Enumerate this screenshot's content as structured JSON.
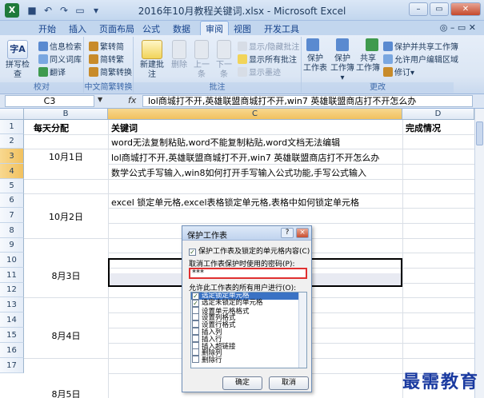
{
  "window": {
    "title": "2016年10月教程关键词.xlsx - Microsoft Excel",
    "app_icon": "X"
  },
  "ribbon_tabs": [
    "开始",
    "插入",
    "页面布局",
    "公式",
    "数据",
    "审阅",
    "视图",
    "开发工具"
  ],
  "active_tab": "审阅",
  "ribbon": {
    "proofing": {
      "label": "校对",
      "spell_check": "拼写检查",
      "research": "信息检索",
      "thesaurus": "同义词库",
      "translate": "翻译"
    },
    "chinese": {
      "label": "中文简繁转换",
      "to_trad": "繁转简",
      "to_simp": "简转繁",
      "convert": "简繁转换"
    },
    "comments": {
      "label": "批注",
      "new": "新建批注",
      "delete": "删除",
      "prev": "上一条",
      "next": "下一条",
      "show_hide": "显示/隐藏批注",
      "show_all": "显示所有批注",
      "show_ink": "显示墨迹"
    },
    "changes": {
      "label": "更改",
      "protect_sheet_1": "保护",
      "protect_sheet_2": "工作表",
      "protect_wb_1": "保护",
      "protect_wb_2": "工作簿",
      "share_1": "共享",
      "share_2": "工作簿",
      "protect_share": "保护并共享工作簿",
      "allow_edit": "允许用户编辑区域",
      "track": "修订"
    }
  },
  "formula_bar": {
    "name_box": "C3",
    "fx": "fx",
    "formula": "lol商城打不开,英雄联盟商城打不开,win7 英雄联盟商店打不开怎么办"
  },
  "columns": [
    "B",
    "C",
    "D"
  ],
  "rows": [
    "1",
    "2",
    "3",
    "4",
    "5",
    "6",
    "7",
    "8",
    "9",
    "10",
    "11",
    "12",
    "13",
    "14",
    "15",
    "16",
    "17"
  ],
  "cells": {
    "b1": "每天分配",
    "c1": "关键词",
    "d1": "完成情况",
    "c2": "word无法复制粘贴,word不能复制粘贴,word文档无法编辑",
    "b_day1": "10月1日",
    "c3": "lol商城打不开,英雄联盟商城打不开,win7 英雄联盟商店打不开怎么办",
    "c4": "数学公式手写输入,win8如何打开手写输入公式功能,手写公式输入",
    "c6": "excel 锁定单元格,excel表格锁定单元格,表格中如何锁定单元格",
    "b_day2": "10月2日",
    "b_day3": "8月3日",
    "b_day4": "8月4日",
    "b_day5": "8月5日"
  },
  "dialog": {
    "title": "保护工作表",
    "help": "?",
    "close": "×",
    "protect_check": "保护工作表及锁定的单元格内容(C)",
    "password_label": "取消工作表保护时使用的密码(P):",
    "password_value": "***",
    "allow_label": "允许此工作表的所有用户进行(O):",
    "permissions": [
      {
        "label": "选定锁定单元格",
        "checked": true
      },
      {
        "label": "选定未锁定的单元格",
        "checked": true
      },
      {
        "label": "设置单元格格式",
        "checked": false
      },
      {
        "label": "设置列格式",
        "checked": false
      },
      {
        "label": "设置行格式",
        "checked": false
      },
      {
        "label": "插入列",
        "checked": false
      },
      {
        "label": "插入行",
        "checked": false
      },
      {
        "label": "插入超链接",
        "checked": false
      },
      {
        "label": "删除列",
        "checked": false
      },
      {
        "label": "删除行",
        "checked": false
      }
    ],
    "ok": "确定",
    "cancel": "取消"
  },
  "watermark": "最需教育"
}
